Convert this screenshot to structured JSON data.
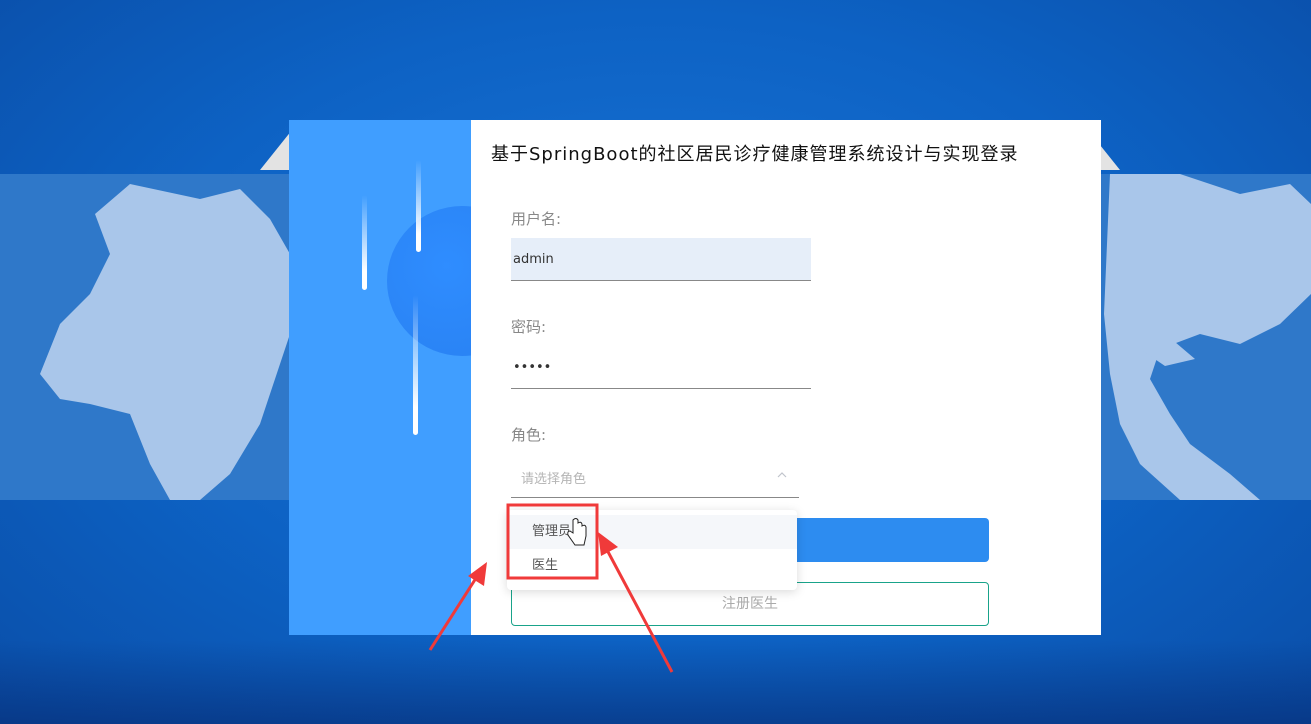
{
  "login": {
    "title": "基于SpringBoot的社区居民诊疗健康管理系统设计与实现登录",
    "username_label": "用户名:",
    "username_value": "admin",
    "password_label": "密码:",
    "password_value": "•••••",
    "role_label": "角色:",
    "role_placeholder": "请选择角色",
    "register_label": "注册医生"
  },
  "role_options": [
    "管理员",
    "医生"
  ],
  "colors": {
    "accent": "#409eff",
    "button": "#2d8cf0",
    "register_border": "#19a38a",
    "annotation": "#f03a3a"
  }
}
